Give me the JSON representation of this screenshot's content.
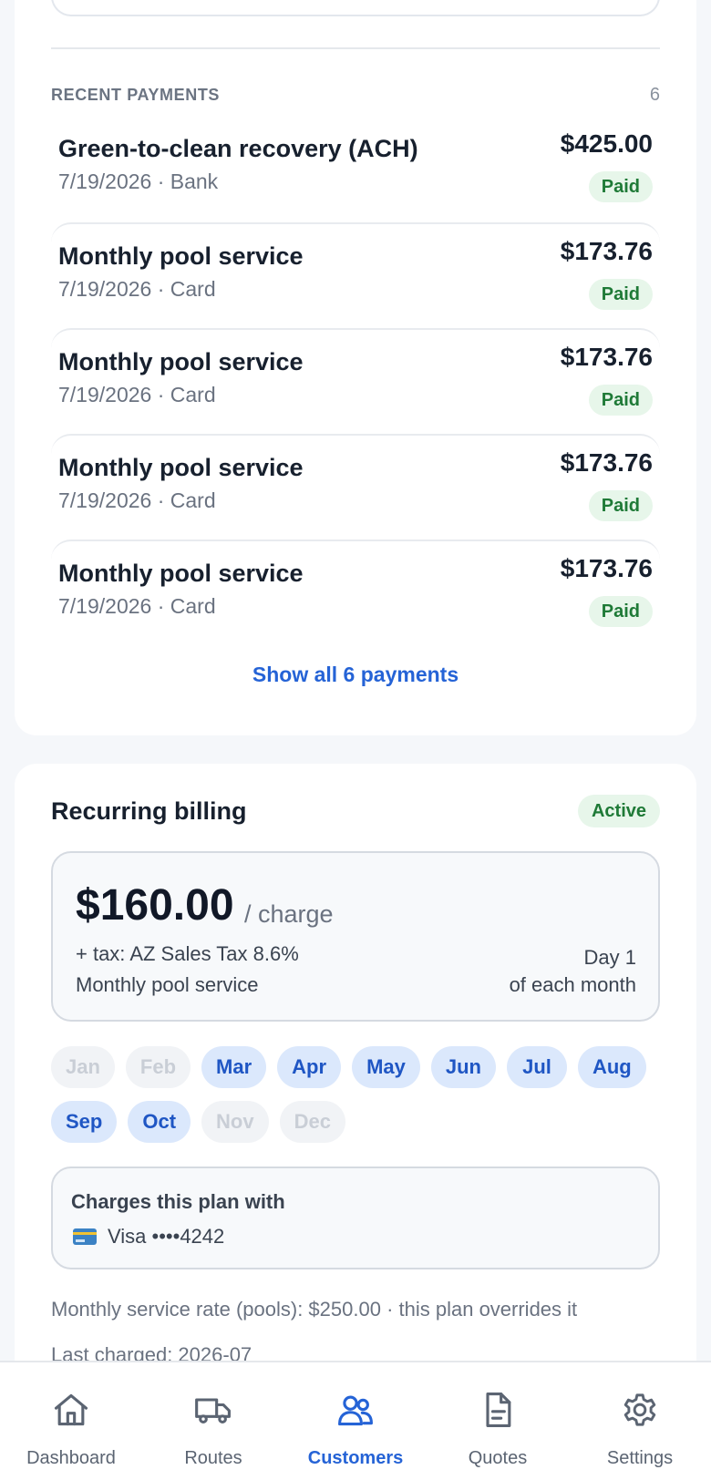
{
  "recent_payments": {
    "title": "RECENT PAYMENTS",
    "count": "6",
    "items": [
      {
        "title": "Green-to-clean recovery (ACH)",
        "sub": "7/19/2026 · Bank",
        "amount": "$425.00",
        "status": "Paid"
      },
      {
        "title": "Monthly pool service",
        "sub": "7/19/2026 · Card",
        "amount": "$173.76",
        "status": "Paid"
      },
      {
        "title": "Monthly pool service",
        "sub": "7/19/2026 · Card",
        "amount": "$173.76",
        "status": "Paid"
      },
      {
        "title": "Monthly pool service",
        "sub": "7/19/2026 · Card",
        "amount": "$173.76",
        "status": "Paid"
      },
      {
        "title": "Monthly pool service",
        "sub": "7/19/2026 · Card",
        "amount": "$173.76",
        "status": "Paid"
      }
    ],
    "show_all": "Show all 6 payments"
  },
  "billing": {
    "title": "Recurring billing",
    "status": "Active",
    "price": "$160.00",
    "unit": "/ charge",
    "tax": "+ tax: AZ Sales Tax 8.6%",
    "description": "Monthly pool service",
    "day": "Day 1",
    "day_suffix": "of each month",
    "months": [
      {
        "label": "Jan",
        "active": false
      },
      {
        "label": "Feb",
        "active": false
      },
      {
        "label": "Mar",
        "active": true
      },
      {
        "label": "Apr",
        "active": true
      },
      {
        "label": "May",
        "active": true
      },
      {
        "label": "Jun",
        "active": true
      },
      {
        "label": "Jul",
        "active": true
      },
      {
        "label": "Aug",
        "active": true
      },
      {
        "label": "Sep",
        "active": true
      },
      {
        "label": "Oct",
        "active": true
      },
      {
        "label": "Nov",
        "active": false
      },
      {
        "label": "Dec",
        "active": false
      }
    ],
    "charges_label": "Charges this plan with",
    "card_label": "Visa ••••4242",
    "rate_note": "Monthly service rate (pools): $250.00 · this plan overrides it",
    "last_charged": "Last charged: 2026-07"
  },
  "nav": {
    "items": [
      {
        "label": "Dashboard",
        "icon": "home-icon",
        "active": false
      },
      {
        "label": "Routes",
        "icon": "truck-icon",
        "active": false
      },
      {
        "label": "Customers",
        "icon": "users-icon",
        "active": true
      },
      {
        "label": "Quotes",
        "icon": "document-icon",
        "active": false
      },
      {
        "label": "Settings",
        "icon": "gear-icon",
        "active": false
      }
    ]
  },
  "colors": {
    "accent": "#2563d6",
    "paid_bg": "#e7f6ea",
    "paid_text": "#1f7a37",
    "month_active_bg": "#dbe8fc",
    "month_inactive_bg": "#f1f3f6"
  }
}
